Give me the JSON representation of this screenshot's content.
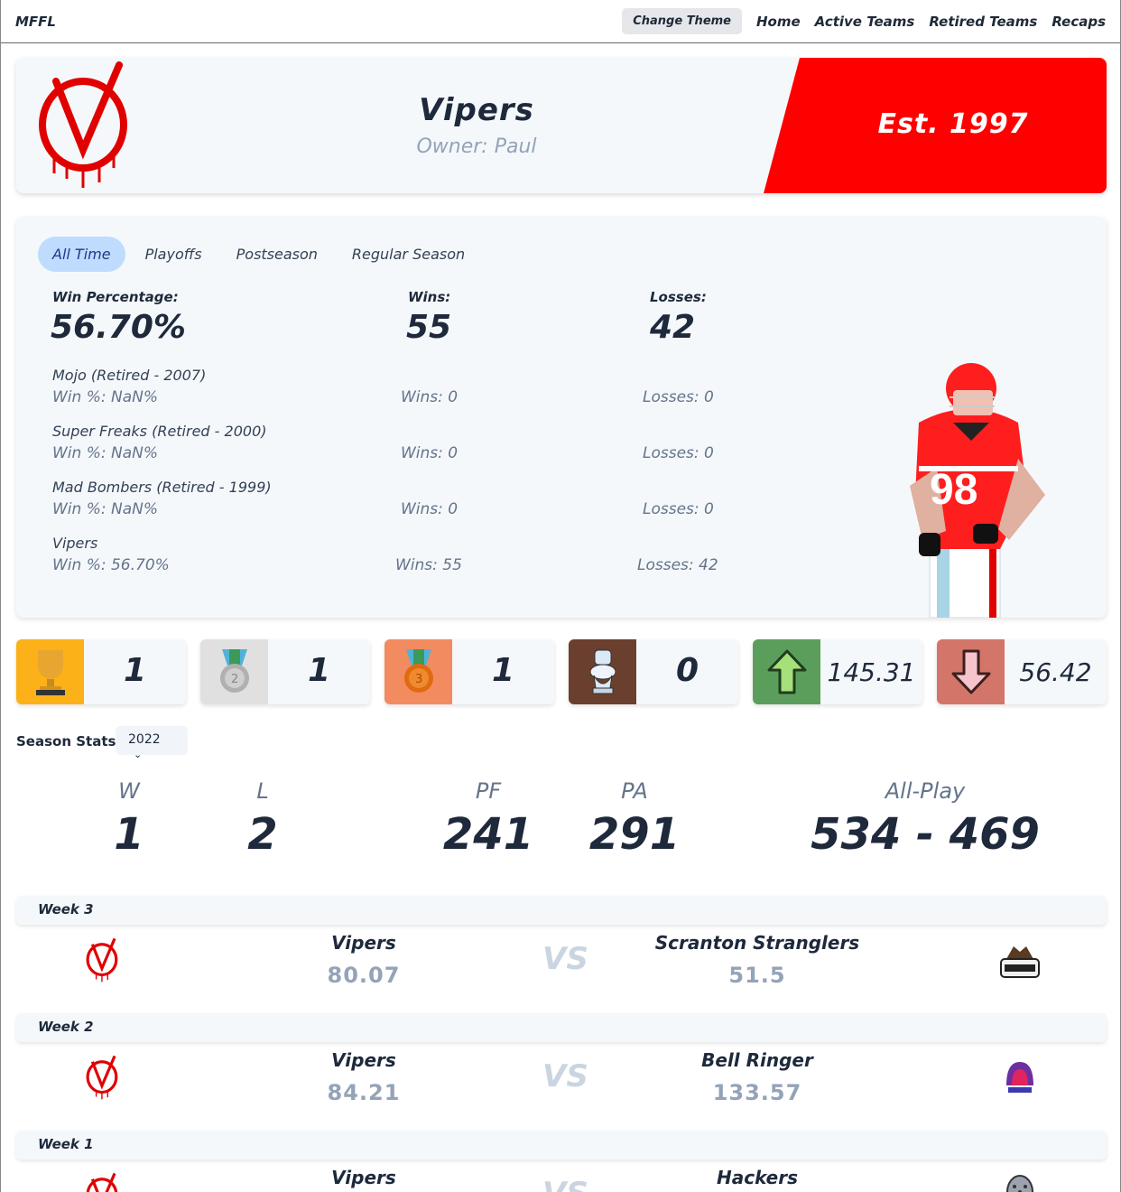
{
  "nav": {
    "brand": "MFFL",
    "theme_button": "Change Theme",
    "links": [
      "Home",
      "Active Teams",
      "Retired Teams",
      "Recaps"
    ]
  },
  "team": {
    "name": "Vipers",
    "owner": "Owner: Paul",
    "established": "Est. 1997",
    "primary_color": "#fe0000"
  },
  "tabs": [
    "All Time",
    "Playoffs",
    "Postseason",
    "Regular Season"
  ],
  "totals": {
    "win_pct_label": "Win Percentage:",
    "win_pct": "56.70%",
    "wins_label": "Wins:",
    "wins": "55",
    "losses_label": "Losses:",
    "losses": "42"
  },
  "history": [
    {
      "name": "Mojo (Retired - 2007)",
      "pct": "Win %: NaN%",
      "wins": "Wins: 0",
      "losses": "Losses: 0"
    },
    {
      "name": "Super Freaks (Retired - 2000)",
      "pct": "Win %: NaN%",
      "wins": "Wins: 0",
      "losses": "Losses: 0"
    },
    {
      "name": "Mad Bombers (Retired - 1999)",
      "pct": "Win %: NaN%",
      "wins": "Wins: 0",
      "losses": "Losses: 0"
    },
    {
      "name": "Vipers",
      "pct": "Win %: 56.70%",
      "wins": "Wins: 55",
      "losses": "Losses: 42"
    }
  ],
  "awards": [
    {
      "icon": "trophy-icon",
      "color": "#fbb117",
      "value": "1"
    },
    {
      "icon": "silver-medal-icon",
      "color": "#e0e0e0",
      "value": "1"
    },
    {
      "icon": "bronze-medal-icon",
      "color": "#f28b60",
      "value": "1"
    },
    {
      "icon": "toilet-icon",
      "color": "#6b3f2e",
      "value": "0"
    },
    {
      "icon": "arrow-up-icon",
      "color": "#5b9e5b",
      "value": "145.31"
    },
    {
      "icon": "arrow-down-icon",
      "color": "#d4756a",
      "value": "56.42"
    }
  ],
  "season": {
    "label": "Season Stats:",
    "selected": "2022",
    "w_label": "W",
    "w": "1",
    "l_label": "L",
    "l": "2",
    "pf_label": "PF",
    "pf": "241",
    "pa_label": "PA",
    "pa": "291",
    "allplay_label": "All-Play",
    "allplay": "534 - 469"
  },
  "matchups": [
    {
      "week": "Week 3",
      "home": "Vipers",
      "home_score": "80.07",
      "vs": "VS",
      "away": "Scranton Stranglers",
      "away_score": "51.5",
      "away_logo": "stranglers-logo"
    },
    {
      "week": "Week 2",
      "home": "Vipers",
      "home_score": "84.21",
      "vs": "VS",
      "away": "Bell Ringer",
      "away_score": "133.57",
      "away_logo": "bell-ringer-logo"
    },
    {
      "week": "Week 1",
      "home": "Vipers",
      "home_score": "",
      "vs": "VS",
      "away": "Hackers",
      "away_score": "",
      "away_logo": "hackers-logo"
    }
  ]
}
